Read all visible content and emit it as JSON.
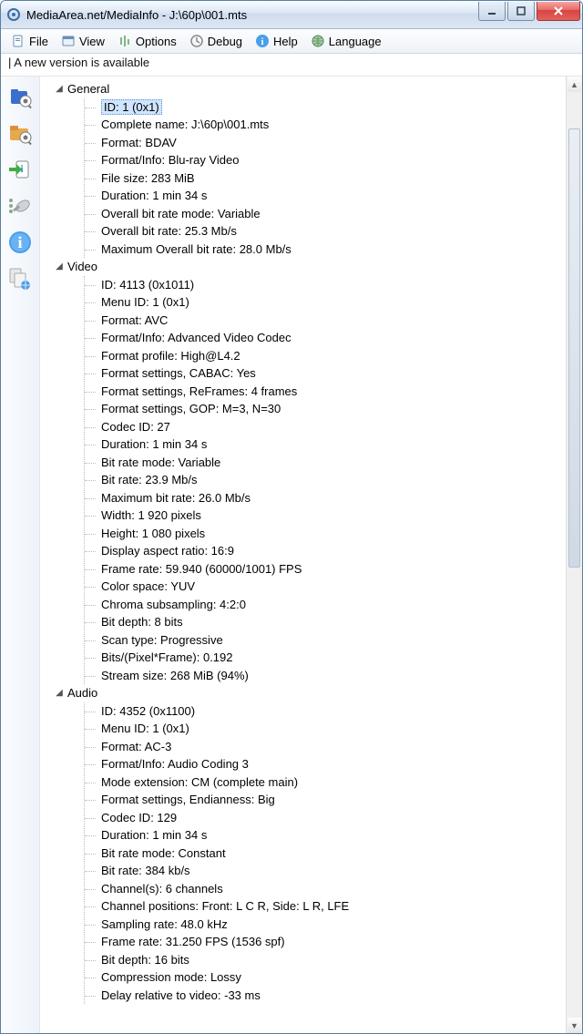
{
  "window": {
    "title": "MediaArea.net/MediaInfo - J:\\60p\\001.mts"
  },
  "menu": {
    "file": "File",
    "view": "View",
    "options": "Options",
    "debug": "Debug",
    "help": "Help",
    "language": "Language"
  },
  "infobar": "| A new version is available",
  "tree": [
    {
      "label": "General",
      "items": [
        "ID: 1 (0x1)",
        "Complete name: J:\\60p\\001.mts",
        "Format: BDAV",
        "Format/Info: Blu-ray Video",
        "File size: 283 MiB",
        "Duration: 1 min 34 s",
        "Overall bit rate mode: Variable",
        "Overall bit rate: 25.3 Mb/s",
        "Maximum Overall bit rate: 28.0 Mb/s"
      ],
      "selected": 0
    },
    {
      "label": "Video",
      "items": [
        "ID: 4113 (0x1011)",
        "Menu ID: 1 (0x1)",
        "Format: AVC",
        "Format/Info: Advanced Video Codec",
        "Format profile: High@L4.2",
        "Format settings, CABAC: Yes",
        "Format settings, ReFrames: 4 frames",
        "Format settings, GOP: M=3, N=30",
        "Codec ID: 27",
        "Duration: 1 min 34 s",
        "Bit rate mode: Variable",
        "Bit rate: 23.9 Mb/s",
        "Maximum bit rate: 26.0 Mb/s",
        "Width: 1 920 pixels",
        "Height: 1 080 pixels",
        "Display aspect ratio: 16:9",
        "Frame rate: 59.940 (60000/1001) FPS",
        "Color space: YUV",
        "Chroma subsampling: 4:2:0",
        "Bit depth: 8 bits",
        "Scan type: Progressive",
        "Bits/(Pixel*Frame): 0.192",
        "Stream size: 268 MiB (94%)"
      ]
    },
    {
      "label": "Audio",
      "items": [
        "ID: 4352 (0x1100)",
        "Menu ID: 1 (0x1)",
        "Format: AC-3",
        "Format/Info: Audio Coding 3",
        "Mode extension: CM (complete main)",
        "Format settings, Endianness: Big",
        "Codec ID: 129",
        "Duration: 1 min 34 s",
        "Bit rate mode: Constant",
        "Bit rate: 384 kb/s",
        "Channel(s): 6 channels",
        "Channel positions: Front: L C R, Side: L R, LFE",
        "Sampling rate: 48.0 kHz",
        "Frame rate: 31.250 FPS (1536 spf)",
        "Bit depth: 16 bits",
        "Compression mode: Lossy",
        "Delay relative to video: -33 ms"
      ]
    }
  ]
}
